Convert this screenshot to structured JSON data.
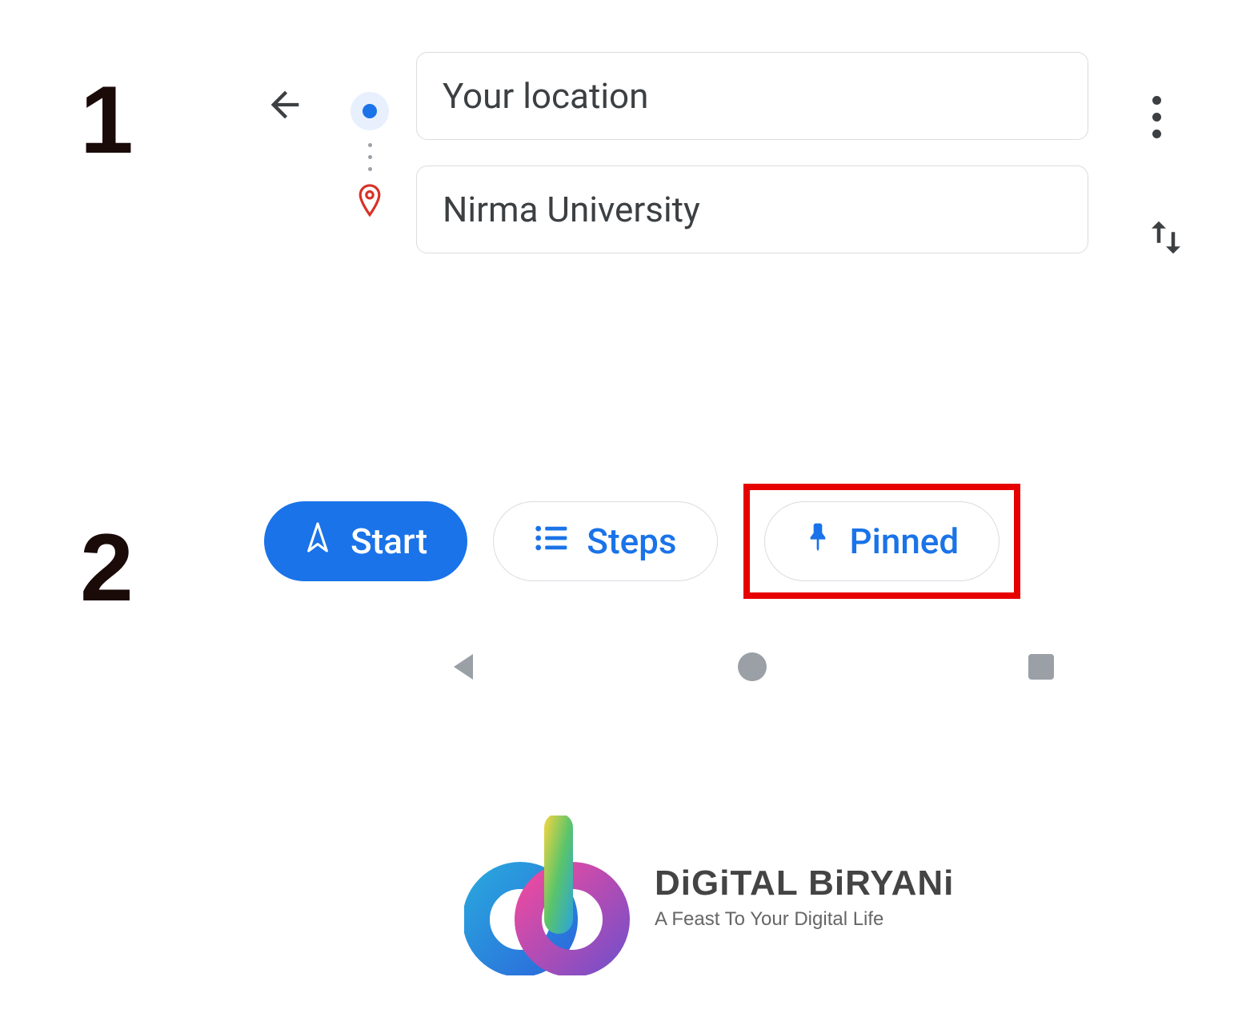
{
  "steps": {
    "one": "1",
    "two": "2"
  },
  "directions": {
    "origin": "Your location",
    "destination": "Nirma University"
  },
  "actions": {
    "start": "Start",
    "steps_btn": "Steps",
    "pinned": "Pinned"
  },
  "footer": {
    "brand_name": "DiGiTAL BiRYANi",
    "tagline": "A Feast To Your Digital Life"
  }
}
